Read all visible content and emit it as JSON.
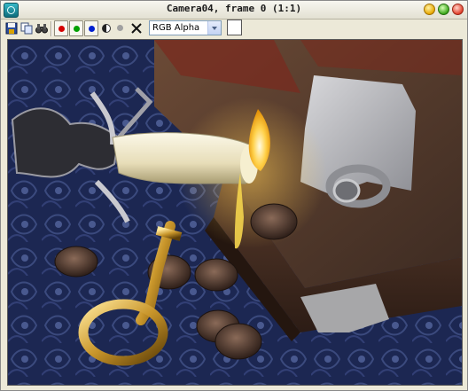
{
  "window": {
    "title": "Camera04, frame 0 (1:1)"
  },
  "toolbar": {
    "buttons": [
      {
        "name": "save-image",
        "icon": "save-icon"
      },
      {
        "name": "clone-window",
        "icon": "clone-icon"
      },
      {
        "name": "print",
        "icon": "binoculars-icon"
      },
      {
        "name": "red-channel",
        "icon": "red-dot-icon",
        "color": "#d40000"
      },
      {
        "name": "green-channel",
        "icon": "green-dot-icon",
        "color": "#00a000"
      },
      {
        "name": "blue-channel",
        "icon": "blue-dot-icon",
        "color": "#0020d0"
      },
      {
        "name": "monochrome",
        "icon": "half-circle-icon"
      },
      {
        "name": "alpha",
        "icon": "gray-dot-icon",
        "color": "#a0a0a0"
      },
      {
        "name": "clear",
        "icon": "x-icon"
      }
    ],
    "channel_select": "RGB Alpha",
    "swatch_color": "#ffffff"
  },
  "scene": {
    "description_colors": {
      "cloth": "#28366e",
      "book": "#5a3f30",
      "candle": "#eee8c8",
      "flame": "#ffd24a",
      "key": "#c9a13a"
    }
  }
}
